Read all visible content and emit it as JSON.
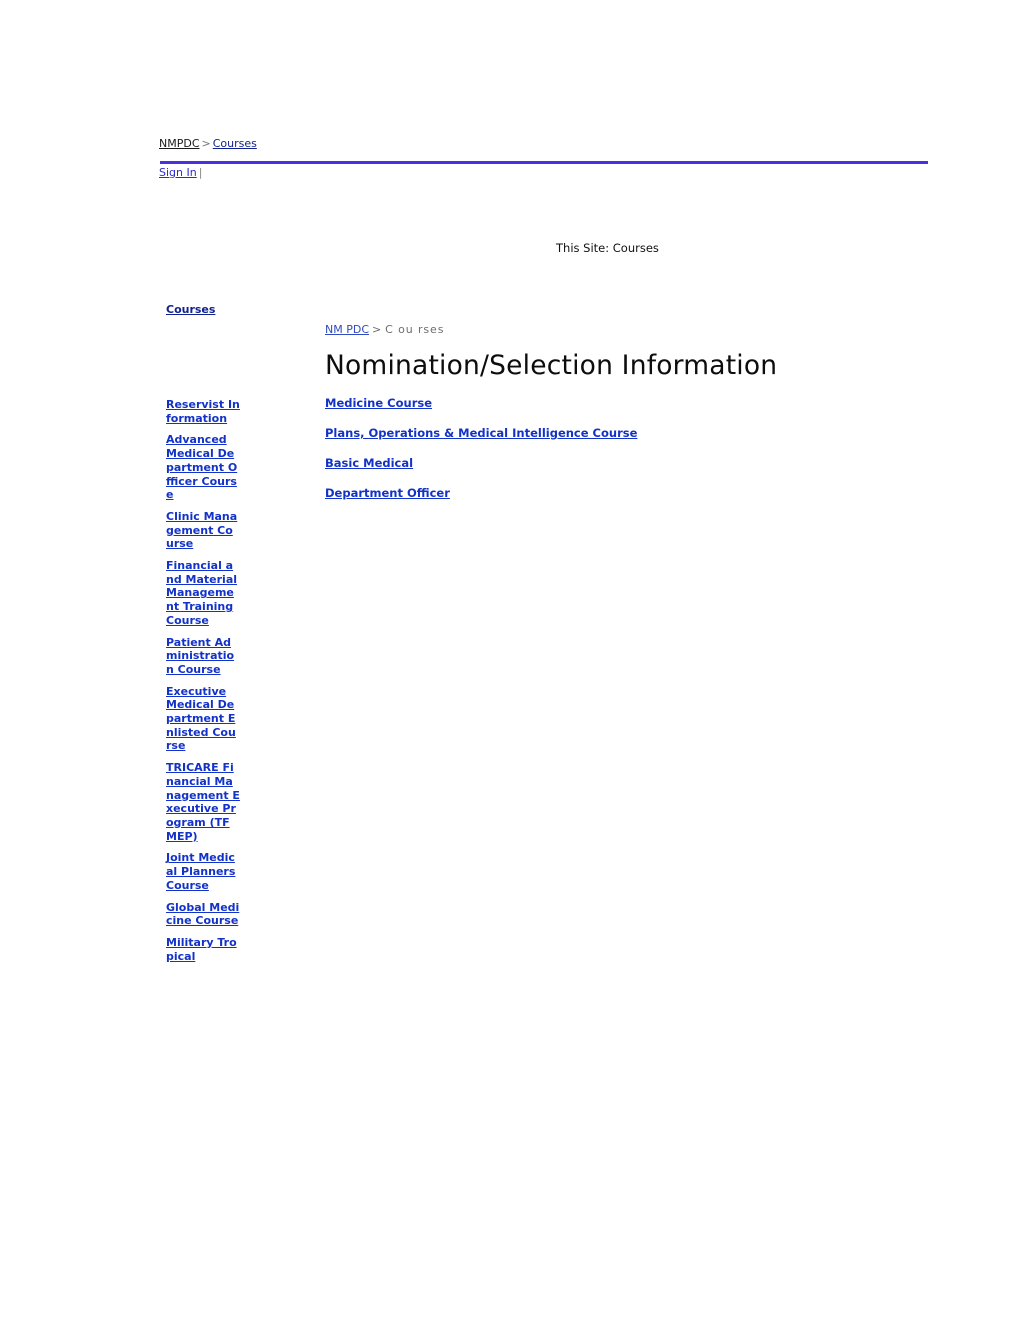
{
  "topnav": {
    "root_label": "NMPDC",
    "separator": ">",
    "current_label": "Courses"
  },
  "signin": {
    "label": "Sign In",
    "divider": "|"
  },
  "search": {
    "scope_label": "This Site: Courses"
  },
  "sidebar": {
    "title": "Courses",
    "items": [
      {
        "label": "Reservist Information"
      },
      {
        "label": "Advanced Medical Department Officer Course"
      },
      {
        "label": "Clinic Management Course"
      },
      {
        "label": "Financial and Material Management Training Course"
      },
      {
        "label": "Patient Administration Course"
      },
      {
        "label": "Executive Medical Department Enlisted Course"
      },
      {
        "label": "TRICARE Financial Management Executive Program (TFMEP)"
      },
      {
        "label": "Joint Medical Planners Course"
      },
      {
        "label": "Global Medicine Course"
      },
      {
        "label": "Military Tropical"
      }
    ]
  },
  "main": {
    "breadcrumb": {
      "root_label": "NM PDC",
      "separator": ">",
      "current_label": "C ou rses"
    },
    "page_title": "Nomination/Selection  Information",
    "course_links": [
      {
        "label": "Medicine Course"
      },
      {
        "label": "Plans, Operations & Medical Intelligence Course"
      },
      {
        "label": "Basic Medical"
      },
      {
        "label": "Department Officer"
      }
    ]
  },
  "colors": {
    "link_blue": "#1232c8",
    "rule_purple": "#4731e0",
    "muted_gray": "#6e6e6e"
  }
}
